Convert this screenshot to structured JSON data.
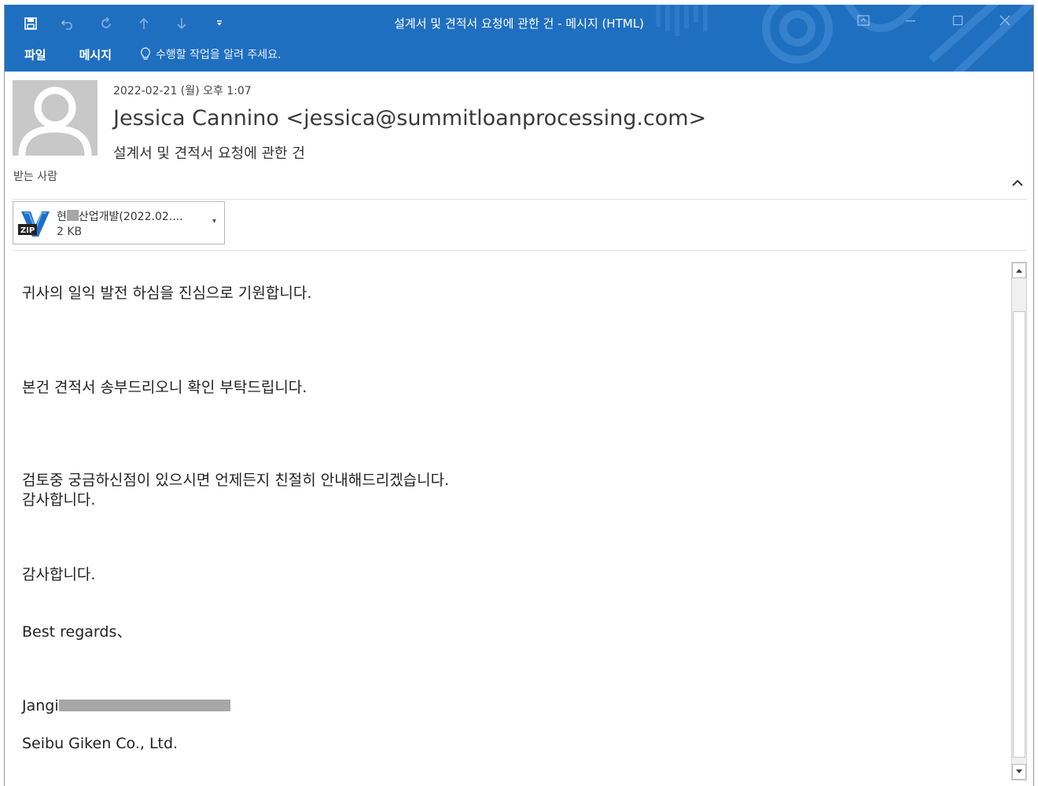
{
  "window": {
    "title": "설계서 및 견적서 요청에 관한 건 - 메시지 (HTML)"
  },
  "menu": {
    "file": "파일",
    "message": "메시지",
    "tell_me": "수행할 작업을 알려 주세요."
  },
  "message": {
    "date": "2022-02-21 (월) 오후 1:07",
    "sender": "Jessica Cannino <jessica@summitloanprocessing.com>",
    "subject": "설계서 및 견적서 요청에 관한 건",
    "to_label": "받는 사람"
  },
  "attachment": {
    "name_prefix": "현",
    "name_suffix": "산업개발(2022.02....",
    "size": "2 KB",
    "icon_text": "ZIP"
  },
  "body": {
    "line1": "귀사의 일익 발전 하심을 진심으로 기원합니다.",
    "line2": "본건 견적서 송부드리오니 확인 부탁드립니다.",
    "line3": "검토중 궁금하신점이 있으시면 언제든지 친절히 안내해드리겠습니다.",
    "line4": "감사합니다.",
    "line5": "감사합니다.",
    "line6": "Best regards、",
    "line7_prefix": "Jangi",
    "line8": "Seibu Giken Co., Ltd."
  },
  "colors": {
    "titlebar": "#1f6fc0",
    "avatar_bg": "#c8c8c8",
    "redaction": "#a7a7a7"
  }
}
